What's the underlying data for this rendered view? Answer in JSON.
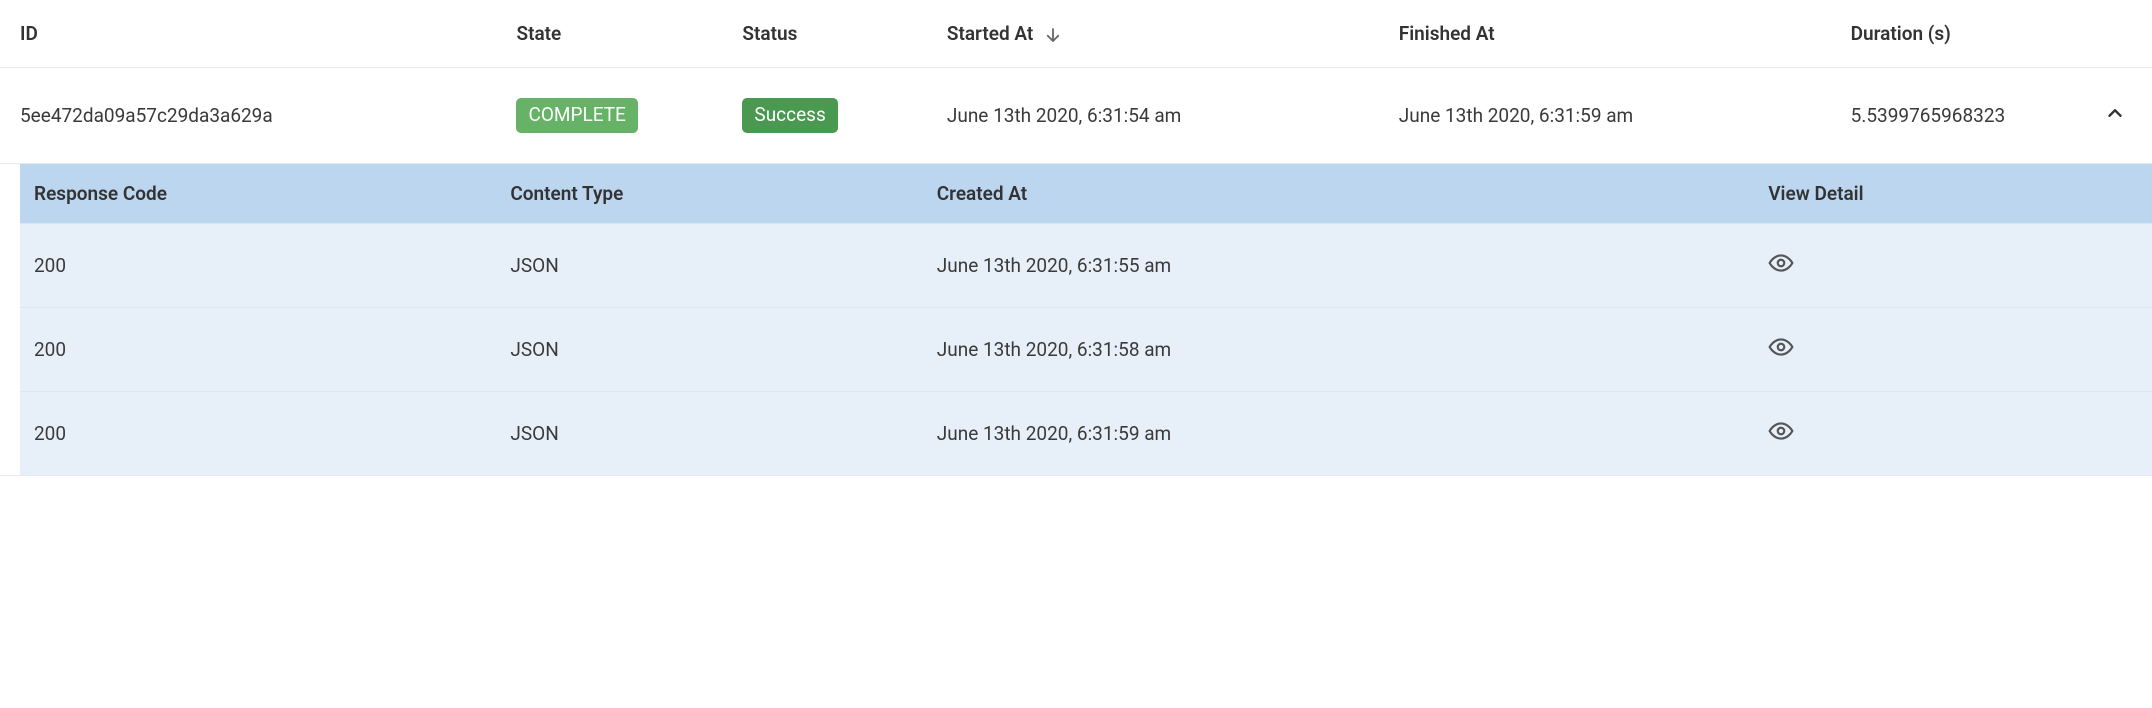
{
  "main_table": {
    "headers": {
      "id": "ID",
      "state": "State",
      "status": "Status",
      "started_at": "Started At",
      "finished_at": "Finished At",
      "duration": "Duration (s)"
    },
    "sort": {
      "column": "started_at",
      "direction": "desc"
    },
    "row": {
      "id": "5ee472da09a57c29da3a629a",
      "state": "COMPLETE",
      "status": "Success",
      "started_at": "June 13th 2020, 6:31:54 am",
      "finished_at": "June 13th 2020, 6:31:59 am",
      "duration": "5.5399765968323",
      "expanded": true
    }
  },
  "nested_table": {
    "headers": {
      "response_code": "Response Code",
      "content_type": "Content Type",
      "created_at": "Created At",
      "view_detail": "View Detail"
    },
    "rows": [
      {
        "response_code": "200",
        "content_type": "JSON",
        "created_at": "June 13th 2020, 6:31:55 am"
      },
      {
        "response_code": "200",
        "content_type": "JSON",
        "created_at": "June 13th 2020, 6:31:58 am"
      },
      {
        "response_code": "200",
        "content_type": "JSON",
        "created_at": "June 13th 2020, 6:31:59 am"
      }
    ]
  }
}
